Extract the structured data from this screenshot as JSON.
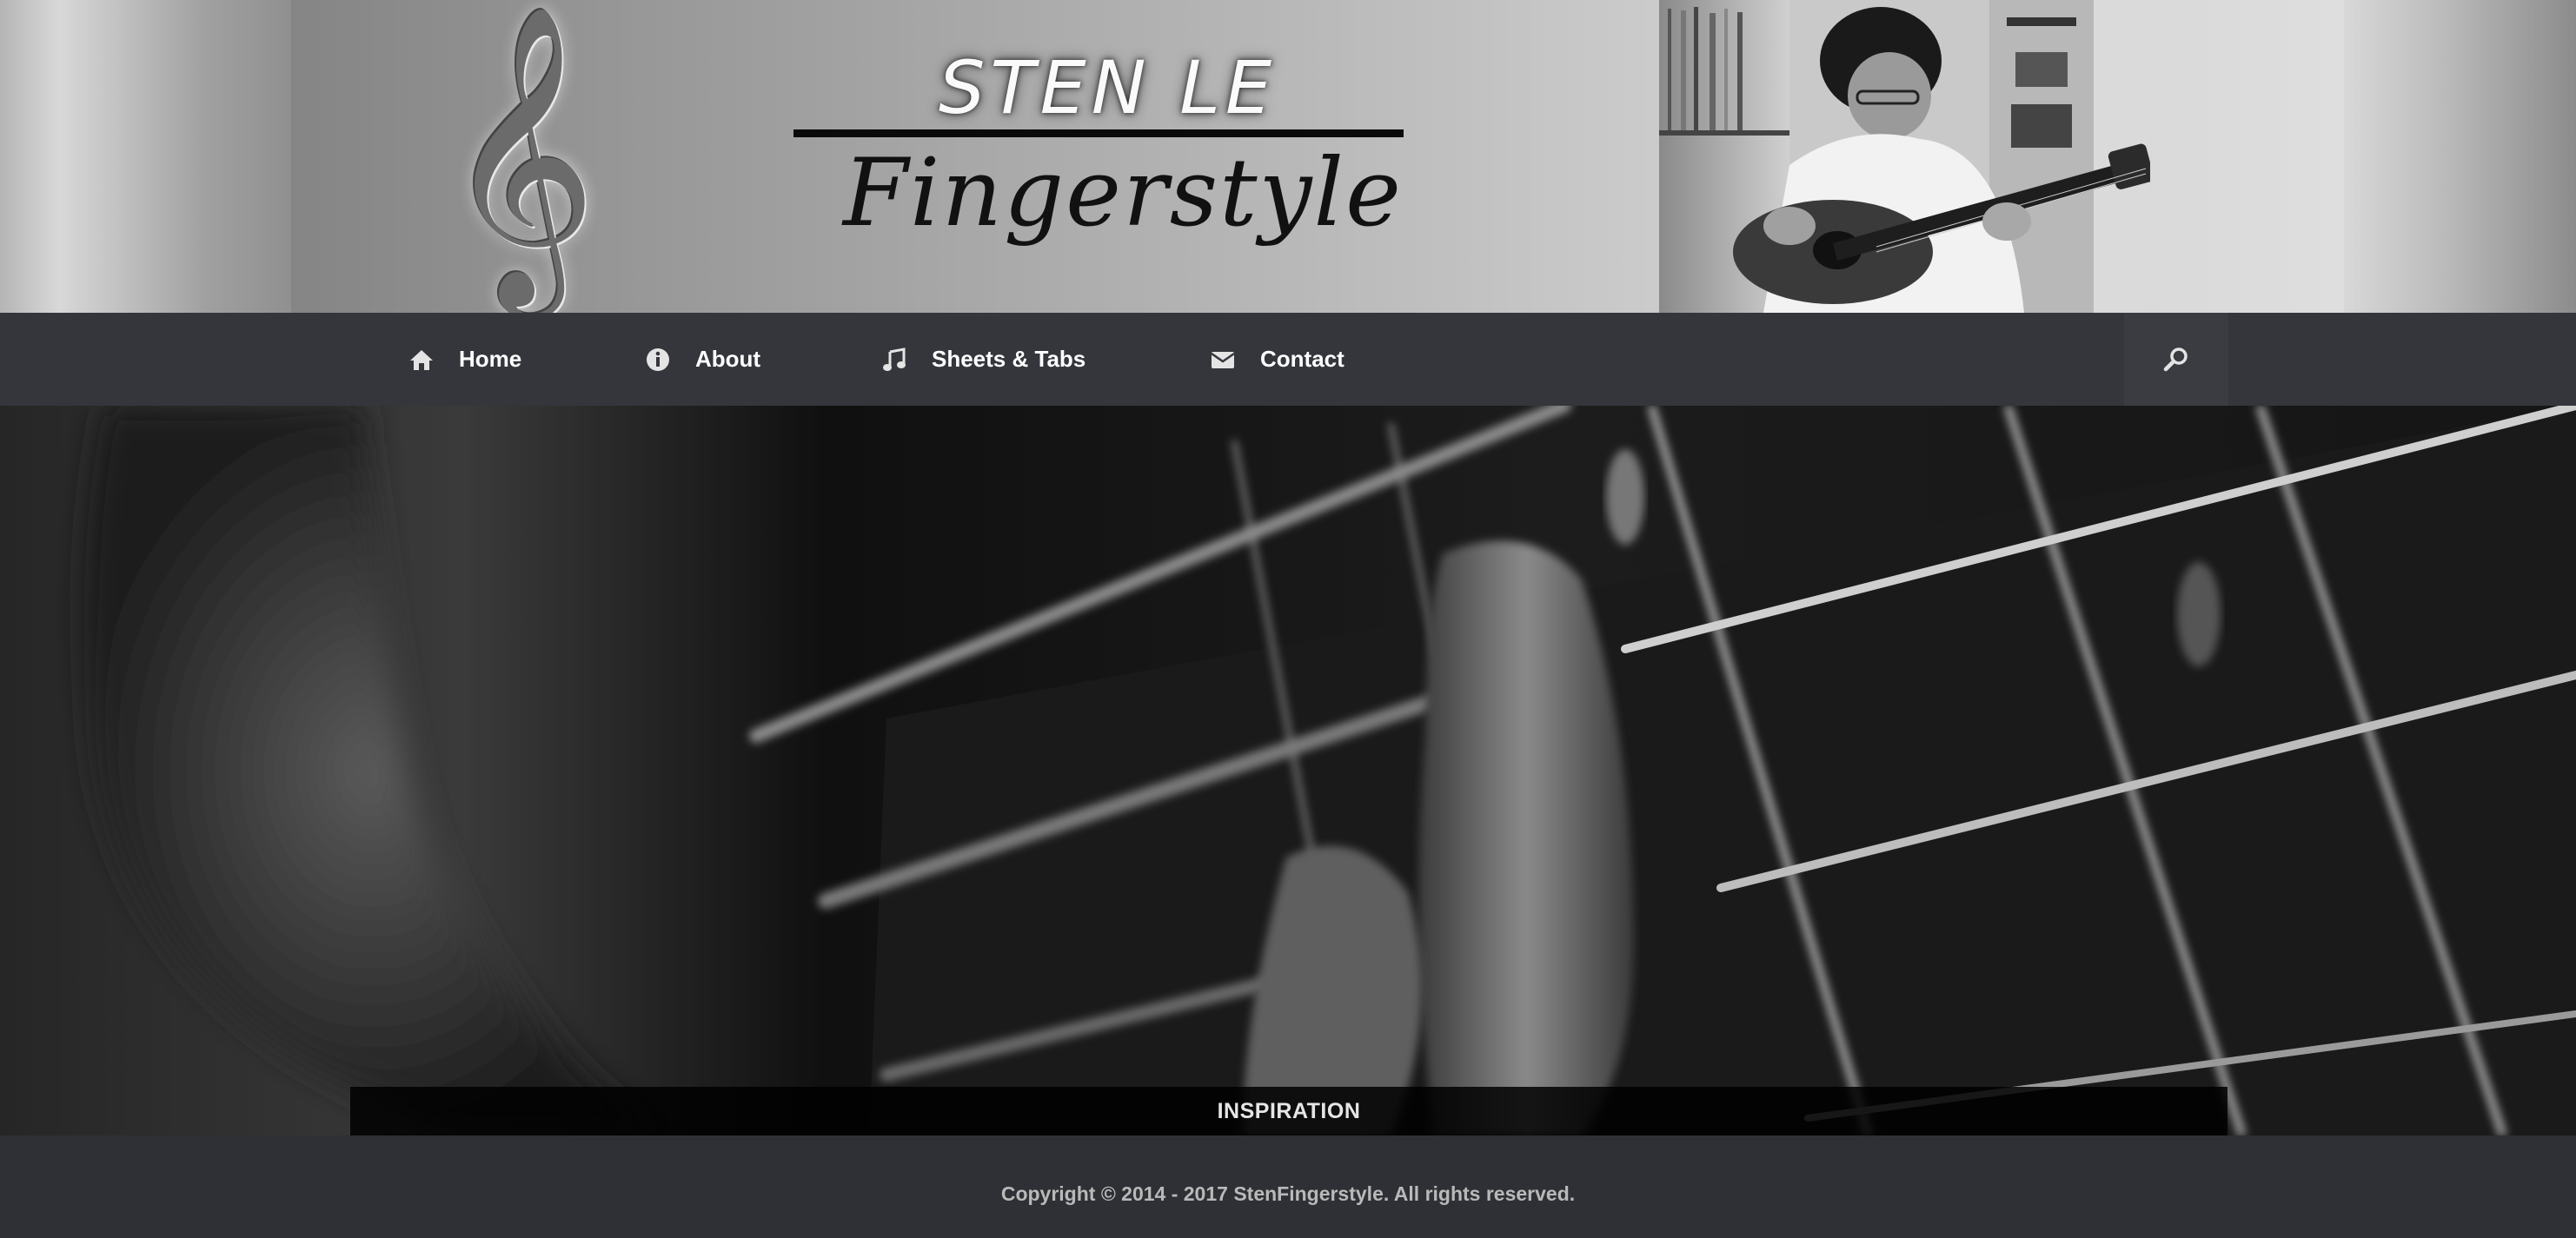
{
  "header": {
    "logo_name": "STEN LE",
    "logo_subtitle": "Fingerstyle"
  },
  "nav": {
    "items": [
      {
        "label": "Home",
        "icon": "home-icon"
      },
      {
        "label": "About",
        "icon": "info-icon"
      },
      {
        "label": "Sheets & Tabs",
        "icon": "music-note-icon"
      },
      {
        "label": "Contact",
        "icon": "envelope-icon"
      }
    ],
    "search_icon": "search-icon"
  },
  "hero": {
    "caption": "INSPIRATION"
  },
  "footer": {
    "copyright": "Copyright © 2014 - 2017 StenFingerstyle. All rights reserved."
  }
}
